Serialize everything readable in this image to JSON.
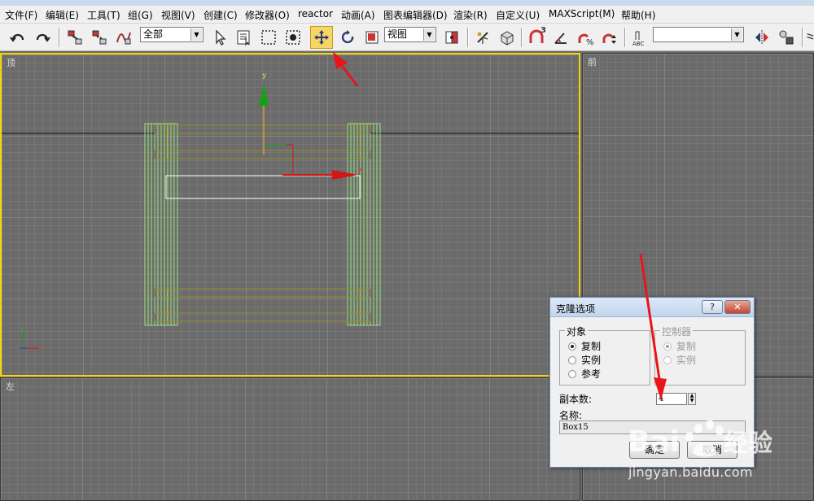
{
  "menu": {
    "items": [
      "文件(F)",
      "编辑(E)",
      "工具(T)",
      "组(G)",
      "视图(V)",
      "创建(C)",
      "修改器(O)",
      "reactor",
      "动画(A)",
      "图表编辑器(D)",
      "渲染(R)",
      "自定义(U)",
      "MAXScript(M)",
      "帮助(H)"
    ]
  },
  "toolbar": {
    "selection_filter": "全部",
    "coord_system": "视图",
    "snap_label": "3",
    "named_selection": ""
  },
  "viewports": {
    "top": "顶",
    "front": "前",
    "left": "左"
  },
  "gizmo": {
    "x_label": "x",
    "y_label": "y"
  },
  "dialog": {
    "title": "克隆选项",
    "help_glyph": "?",
    "close_glyph": "✕",
    "object_group": {
      "title": "对象",
      "options": [
        "复制",
        "实例",
        "参考"
      ],
      "selected": "复制"
    },
    "controller_group": {
      "title": "控制器",
      "options": [
        "复制",
        "实例"
      ],
      "selected": "复制"
    },
    "copies_label": "副本数:",
    "copies_value": "4",
    "name_label": "名称:",
    "name_value": "Box15",
    "ok_label": "确定",
    "cancel_label": "取消"
  },
  "watermark": {
    "brand": "Baidu经验",
    "url": "jingyan.baidu.com"
  },
  "colors": {
    "active_viewport_border": "#f2d60a",
    "annotation_arrow": "#e8151b",
    "selected_wire": "#ffffff",
    "object_wire": "#9be37c",
    "gizmo_x": "#d31515",
    "gizmo_y": "#13a313"
  },
  "icons": [
    "undo-icon",
    "redo-icon",
    "select-and-link-icon",
    "unlink-icon",
    "bind-space-warp-icon",
    "select-object-icon",
    "select-by-name-icon",
    "rectangle-region-icon",
    "window-crossing-icon",
    "select-and-move-icon",
    "select-and-rotate-icon",
    "select-and-scale-icon",
    "use-pivot-center-icon",
    "select-manipulate-icon",
    "keyboard-shortcut-icon",
    "snaps-toggle-icon",
    "angle-snap-icon",
    "percent-snap-icon",
    "spinner-snap-icon",
    "edit-named-selection-icon",
    "mirror-icon",
    "align-icon"
  ]
}
